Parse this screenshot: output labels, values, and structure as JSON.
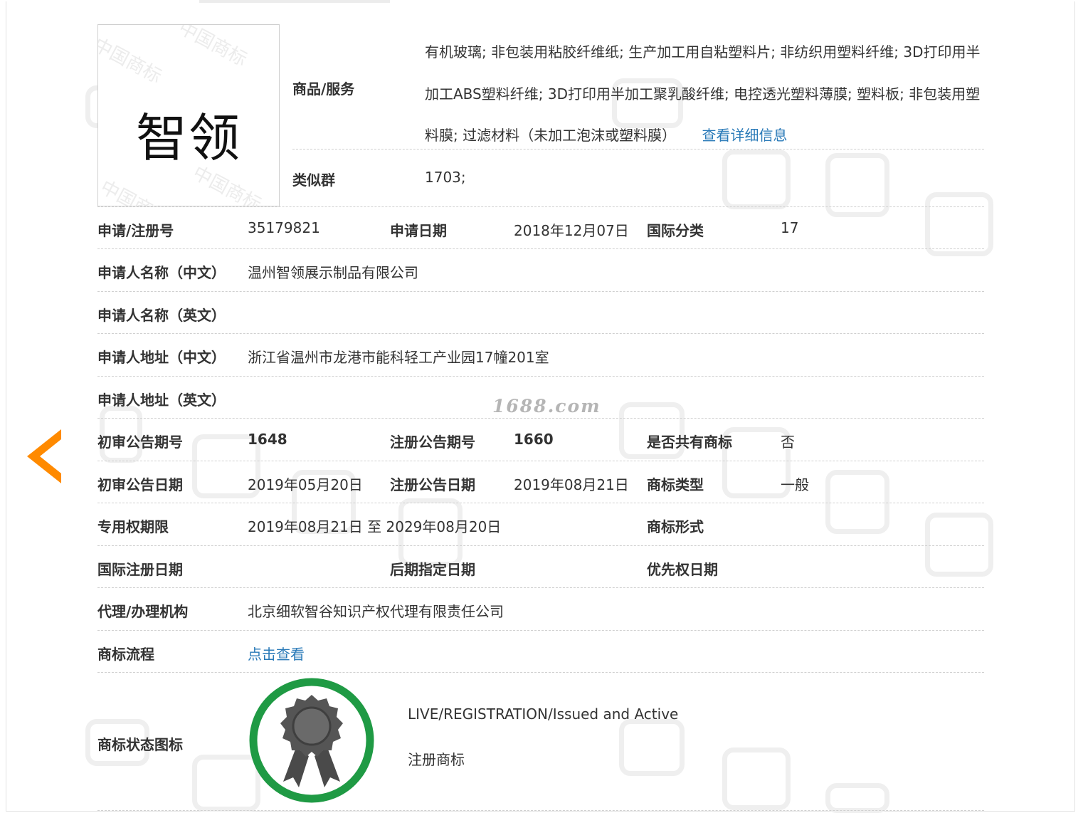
{
  "trademark": {
    "logo_text": "智领",
    "logo_watermark": "中国商标"
  },
  "goods": {
    "label": "商品/服务",
    "text": "有机玻璃; 非包装用粘胶纤维纸; 生产加工用自粘塑料片; 非纺织用塑料纤维; 3D打印用半加工ABS塑料纤维; 3D打印用半加工聚乳酸纤维; 电控透光塑料薄膜; 塑料板; 非包装用塑料膜; 过滤材料（未加工泡沫或塑料膜）",
    "detail_link": "查看详细信息"
  },
  "similar_group": {
    "label": "类似群",
    "value": "1703;"
  },
  "fields": {
    "reg_no": {
      "label": "申请/注册号",
      "value": "35179821"
    },
    "apply_date": {
      "label": "申请日期",
      "value": "2018年12月07日"
    },
    "intl_class": {
      "label": "国际分类",
      "value": "17"
    },
    "applicant_cn": {
      "label": "申请人名称（中文）",
      "value": "温州智领展示制品有限公司"
    },
    "applicant_en": {
      "label": "申请人名称（英文）",
      "value": ""
    },
    "address_cn": {
      "label": "申请人地址（中文）",
      "value": "浙江省温州市龙港市能科轻工产业园17幢201室"
    },
    "address_en": {
      "label": "申请人地址（英文）",
      "value": ""
    },
    "prelim_no": {
      "label": "初审公告期号",
      "value": "1648"
    },
    "reg_pub_no": {
      "label": "注册公告期号",
      "value": "1660"
    },
    "shared": {
      "label": "是否共有商标",
      "value": "否"
    },
    "prelim_date": {
      "label": "初审公告日期",
      "value": "2019年05月20日"
    },
    "reg_pub_date": {
      "label": "注册公告日期",
      "value": "2019年08月21日"
    },
    "tm_type": {
      "label": "商标类型",
      "value": "一般"
    },
    "exclusive_period": {
      "label": "专用权期限",
      "value": "2019年08月21日 至 2029年08月20日"
    },
    "tm_form": {
      "label": "商标形式",
      "value": ""
    },
    "intl_reg_date": {
      "label": "国际注册日期",
      "value": ""
    },
    "later_designation": {
      "label": "后期指定日期",
      "value": ""
    },
    "priority_date": {
      "label": "优先权日期",
      "value": ""
    },
    "agent": {
      "label": "代理/办理机构",
      "value": "北京细软智谷知识产权代理有限责任公司"
    },
    "process": {
      "label": "商标流程",
      "link": "点击查看"
    },
    "status": {
      "label": "商标状态图标",
      "status_en": "LIVE/REGISTRATION/Issued and Active",
      "status_cn": "注册商标"
    }
  },
  "site_watermark": "1688.com",
  "colors": {
    "link": "#2a7ab8",
    "arrow": "#ff8a00",
    "badge_ring": "#1f9a44",
    "badge_seal": "#555555"
  },
  "icons": {
    "prev": "chevron-left-icon",
    "badge": "award-ribbon-icon"
  }
}
